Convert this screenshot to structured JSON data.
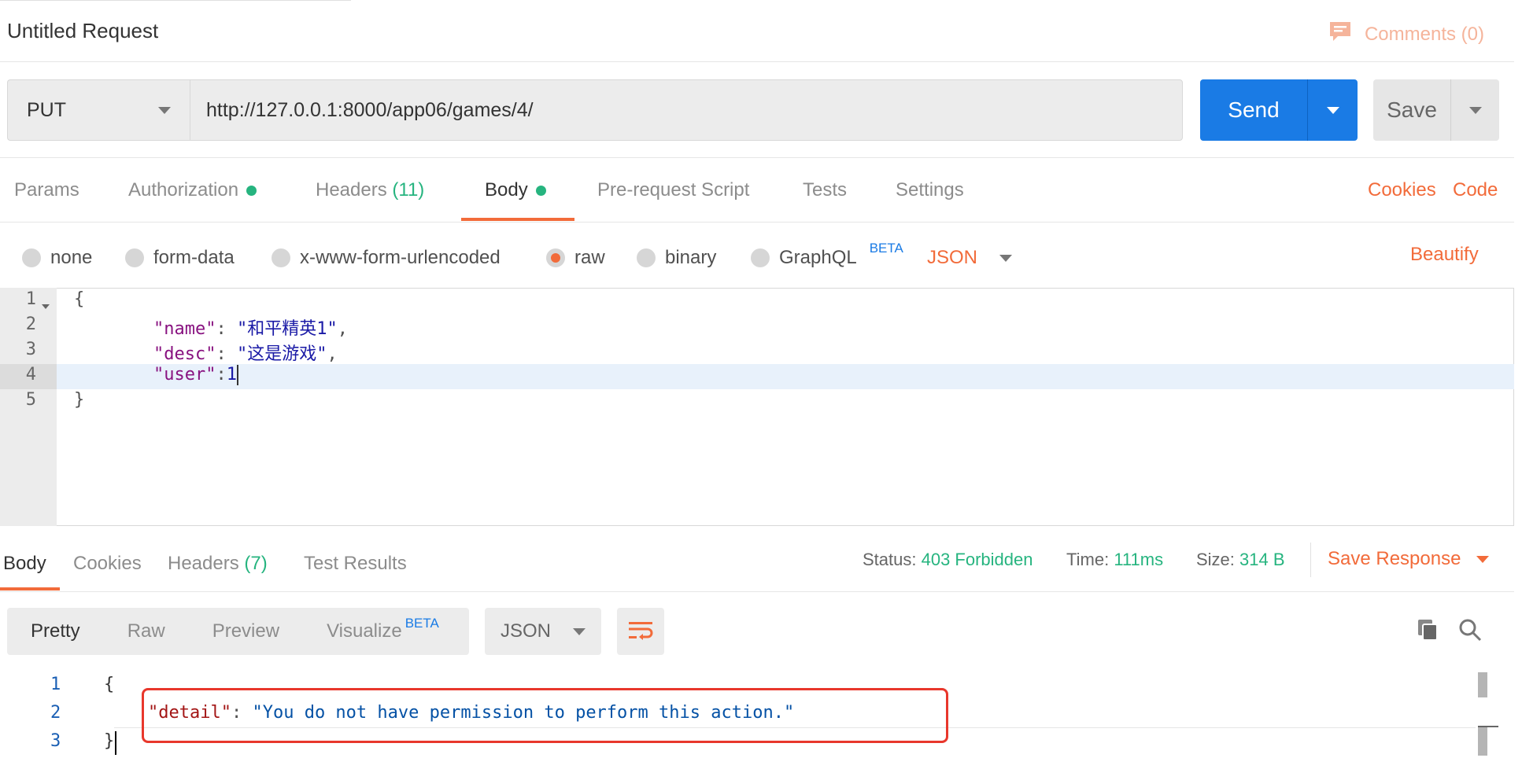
{
  "header": {
    "title": "Untitled Request",
    "comments_label": "Comments (0)"
  },
  "request": {
    "method": "PUT",
    "url": "http://127.0.0.1:8000/app06/games/4/",
    "send_label": "Send",
    "save_label": "Save"
  },
  "tabs": {
    "params": "Params",
    "authorization": "Authorization",
    "headers": "Headers",
    "headers_count": "(11)",
    "body": "Body",
    "prerequest": "Pre-request Script",
    "tests": "Tests",
    "settings": "Settings",
    "cookies": "Cookies",
    "code": "Code"
  },
  "body_options": {
    "none": "none",
    "form_data": "form-data",
    "urlencoded": "x-www-form-urlencoded",
    "raw": "raw",
    "binary": "binary",
    "graphql": "GraphQL",
    "graphql_badge": "BETA",
    "format": "JSON",
    "beautify": "Beautify"
  },
  "request_body": {
    "line_numbers": [
      "1",
      "2",
      "3",
      "4",
      "5"
    ],
    "open_brace": "{",
    "close_brace": "}",
    "name_key": "\"name\"",
    "name_value": "\"和平精英1\"",
    "desc_key": "\"desc\"",
    "desc_value": "\"这是游戏\"",
    "user_key": "\"user\"",
    "user_value": "1"
  },
  "response": {
    "tabs": {
      "body": "Body",
      "cookies": "Cookies",
      "headers": "Headers",
      "headers_count": "(7)",
      "test_results": "Test Results"
    },
    "status_label": "Status:",
    "status_value": "403 Forbidden",
    "time_label": "Time:",
    "time_value": "111ms",
    "size_label": "Size:",
    "size_value": "314 B",
    "save_response": "Save Response",
    "views": {
      "pretty": "Pretty",
      "raw": "Raw",
      "preview": "Preview",
      "visualize": "Visualize",
      "visualize_badge": "BETA"
    },
    "format": "JSON",
    "line_numbers": [
      "1",
      "2",
      "3"
    ],
    "open_brace": "{",
    "close_brace": "}",
    "detail_key": "\"detail\"",
    "detail_value": "\"You do not have permission to perform this action.\""
  },
  "colors": {
    "accent": "#f26b3a",
    "send": "#1a7be5",
    "success": "#26b47f",
    "highlight_box": "#e8372c"
  }
}
